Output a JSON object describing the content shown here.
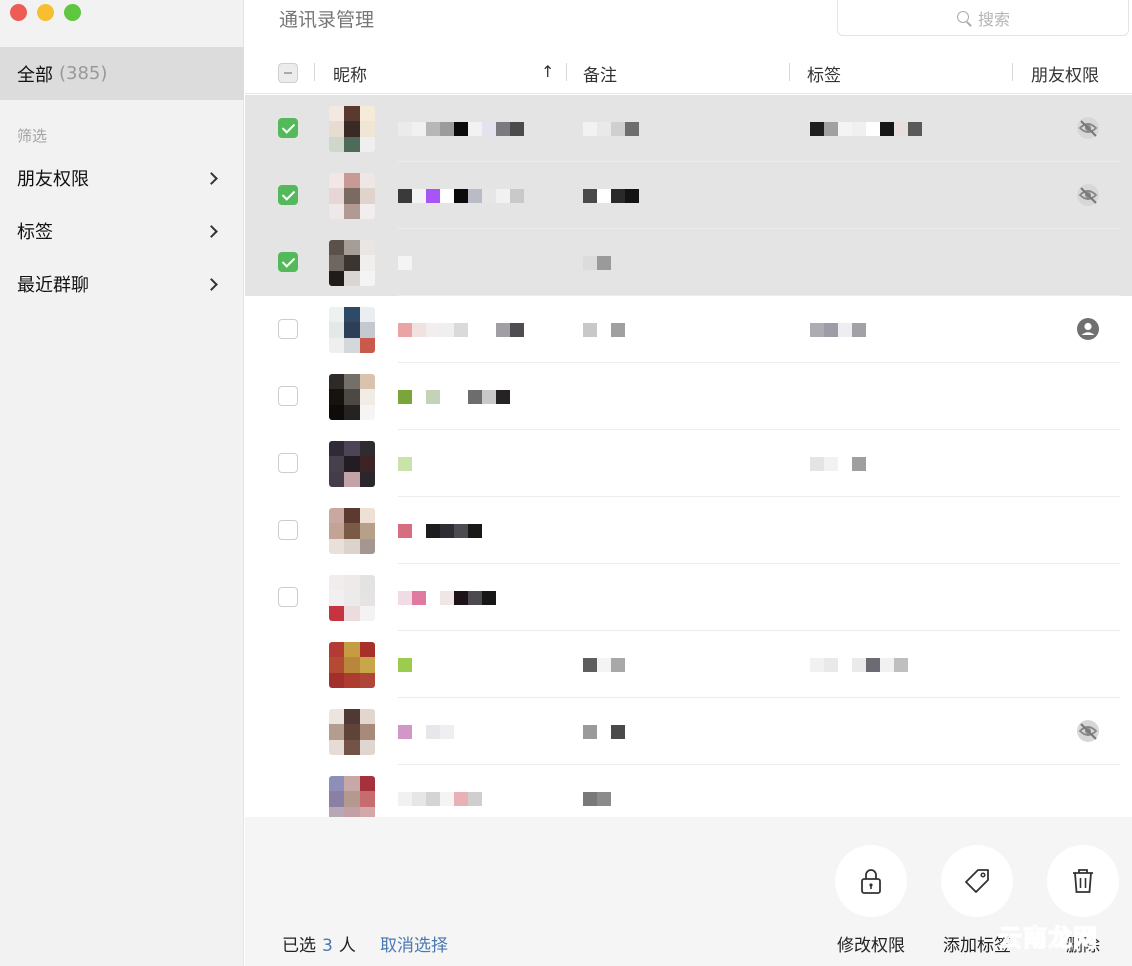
{
  "window": {
    "traffic_lights": [
      "close",
      "minimize",
      "zoom"
    ]
  },
  "sidebar": {
    "all_label": "全部",
    "all_count": "(385)",
    "filter_heading": "筛选",
    "items": [
      {
        "label": "朋友权限"
      },
      {
        "label": "标签"
      },
      {
        "label": "最近群聊"
      }
    ]
  },
  "header": {
    "title": "通讯录管理",
    "search_placeholder": "搜索"
  },
  "table": {
    "columns": [
      "昵称",
      "备注",
      "标签",
      "朋友权限"
    ],
    "sort_indicator": "↑",
    "rows": [
      {
        "selected": true,
        "status_icon": "eye-off-icon"
      },
      {
        "selected": true,
        "status_icon": "eye-off-icon"
      },
      {
        "selected": true,
        "status_icon": ""
      },
      {
        "selected": false,
        "status_icon": "person-circle-icon"
      },
      {
        "selected": false,
        "status_icon": ""
      },
      {
        "selected": false,
        "status_icon": ""
      },
      {
        "selected": false,
        "status_icon": ""
      },
      {
        "selected": false,
        "status_icon": ""
      },
      {
        "selected": false,
        "status_icon": ""
      },
      {
        "selected": false,
        "status_icon": "eye-off-icon"
      },
      {
        "selected": false,
        "status_icon": ""
      }
    ]
  },
  "footer": {
    "selected_prefix": "已选",
    "selected_count": "3",
    "selected_suffix": "人",
    "cancel_label": "取消选择",
    "actions": [
      {
        "label": "修改权限",
        "icon": "lock-icon"
      },
      {
        "label": "添加标签",
        "icon": "tag-icon"
      },
      {
        "label": "删除",
        "icon": "trash-icon"
      }
    ]
  },
  "watermark": "云南龙网",
  "colors": {
    "accent_green": "#54b95a",
    "link_blue": "#4a78b2",
    "selected_row": "#e4e4e4",
    "sidebar_bg": "#f2f2f2"
  }
}
